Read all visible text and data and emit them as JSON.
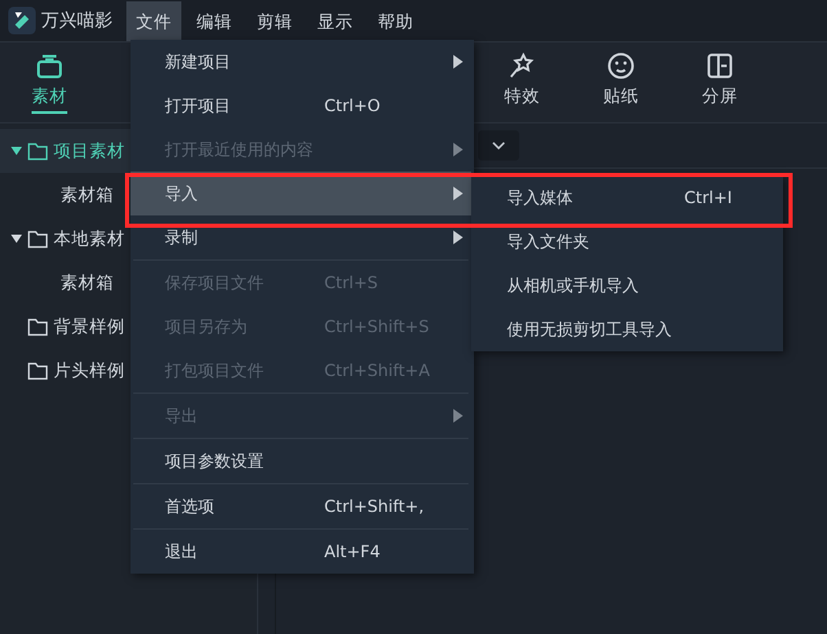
{
  "app": {
    "title": "万兴喵影"
  },
  "menubar": [
    {
      "label": "文件",
      "selected": true
    },
    {
      "label": "编辑",
      "selected": false
    },
    {
      "label": "剪辑",
      "selected": false
    },
    {
      "label": "显示",
      "selected": false
    },
    {
      "label": "帮助",
      "selected": false
    }
  ],
  "toolbar": [
    {
      "label": "素材",
      "selected": true,
      "kind": "media"
    },
    {
      "label": "特效",
      "selected": false,
      "kind": "effects"
    },
    {
      "label": "贴纸",
      "selected": false,
      "kind": "sticker"
    },
    {
      "label": "分屏",
      "selected": false,
      "kind": "split"
    }
  ],
  "tree": [
    {
      "label": "项目素材",
      "expanded": true,
      "selected": true,
      "children": [
        {
          "label": "素材箱"
        }
      ]
    },
    {
      "label": "本地素材",
      "expanded": true,
      "selected": false,
      "children": [
        {
          "label": "素材箱"
        }
      ]
    },
    {
      "label": "背景样例",
      "expanded": false,
      "selected": false
    },
    {
      "label": "片头样例",
      "expanded": false,
      "selected": false
    }
  ],
  "file_menu": [
    {
      "label": "新建项目",
      "submenu": true,
      "disabled": false,
      "selected": false
    },
    {
      "label": "打开项目",
      "shortcut": "Ctrl+O",
      "submenu": false,
      "disabled": false,
      "selected": false
    },
    {
      "label": "打开最近使用的内容",
      "submenu": true,
      "disabled": true,
      "selected": false
    },
    {
      "label": "导入",
      "submenu": true,
      "disabled": false,
      "selected": true
    },
    {
      "label": "录制",
      "submenu": true,
      "disabled": false,
      "selected": false,
      "separator_after": true
    },
    {
      "label": "保存项目文件",
      "shortcut": "Ctrl+S",
      "submenu": false,
      "disabled": true,
      "selected": false
    },
    {
      "label": "项目另存为",
      "shortcut": "Ctrl+Shift+S",
      "submenu": false,
      "disabled": true,
      "selected": false
    },
    {
      "label": "打包项目文件",
      "shortcut": "Ctrl+Shift+A",
      "submenu": false,
      "disabled": true,
      "selected": false,
      "separator_after": true
    },
    {
      "label": "导出",
      "submenu": true,
      "disabled": true,
      "selected": false,
      "separator_after": true
    },
    {
      "label": "项目参数设置",
      "submenu": false,
      "disabled": false,
      "selected": false,
      "separator_after": true
    },
    {
      "label": "首选项",
      "shortcut": "Ctrl+Shift+,",
      "submenu": false,
      "disabled": false,
      "selected": false,
      "separator_after": true
    },
    {
      "label": "退出",
      "shortcut": "Alt+F4",
      "submenu": false,
      "disabled": false,
      "selected": false
    }
  ],
  "import_submenu": [
    {
      "label": "导入媒体",
      "shortcut": "Ctrl+I"
    },
    {
      "label": "导入文件夹"
    },
    {
      "label": "从相机或手机导入"
    },
    {
      "label": "使用无损剪切工具导入"
    }
  ]
}
